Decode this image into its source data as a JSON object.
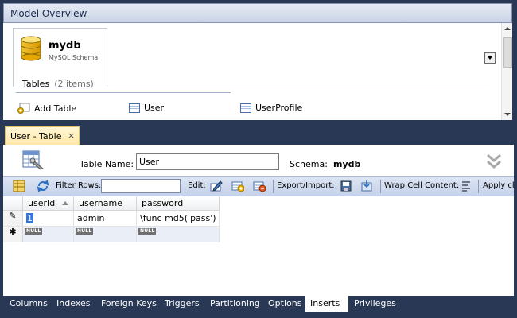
{
  "model_overview": {
    "title": "Model Overview",
    "schema_name": "mydb",
    "schema_sub": "MySQL Schema",
    "tables_label": "Tables",
    "tables_count": "(2 items)",
    "items": [
      {
        "label": "Add Table",
        "icon": "add-table-icon"
      },
      {
        "label": "User",
        "icon": "table-icon"
      },
      {
        "label": "UserProfile",
        "icon": "table-icon"
      }
    ]
  },
  "editor_tab": {
    "label": "User - Table",
    "close": "×"
  },
  "editor": {
    "table_name_label": "Table Name:",
    "table_name_value": "User",
    "schema_label": "Schema:",
    "schema_value": "mydb"
  },
  "toolbar": {
    "filter_label": "Filter Rows:",
    "edit_label": "Edit:",
    "export_label": "Export/Import:",
    "wrap_label": "Wrap Cell Content:",
    "apply_label": "Apply ch"
  },
  "grid": {
    "columns": [
      "userId",
      "username",
      "password"
    ],
    "rows": [
      {
        "marker": "✎",
        "values": [
          "1",
          "admin",
          "\\func md5('pass')"
        ]
      },
      {
        "marker": "✱",
        "values": [
          "NULL",
          "NULL",
          "NULL"
        ]
      }
    ]
  },
  "bottom_tabs": [
    {
      "label": "Columns",
      "active": false
    },
    {
      "label": "Indexes",
      "active": false
    },
    {
      "label": "Foreign Keys",
      "active": false
    },
    {
      "label": "Triggers",
      "active": false
    },
    {
      "label": "Partitioning",
      "active": false
    },
    {
      "label": "Options",
      "active": false
    },
    {
      "label": "Inserts",
      "active": true
    },
    {
      "label": "Privileges",
      "active": false
    }
  ],
  "colors": {
    "frame": "#293955",
    "tab_active": "#ffe8a6",
    "selection": "#3875d7"
  }
}
